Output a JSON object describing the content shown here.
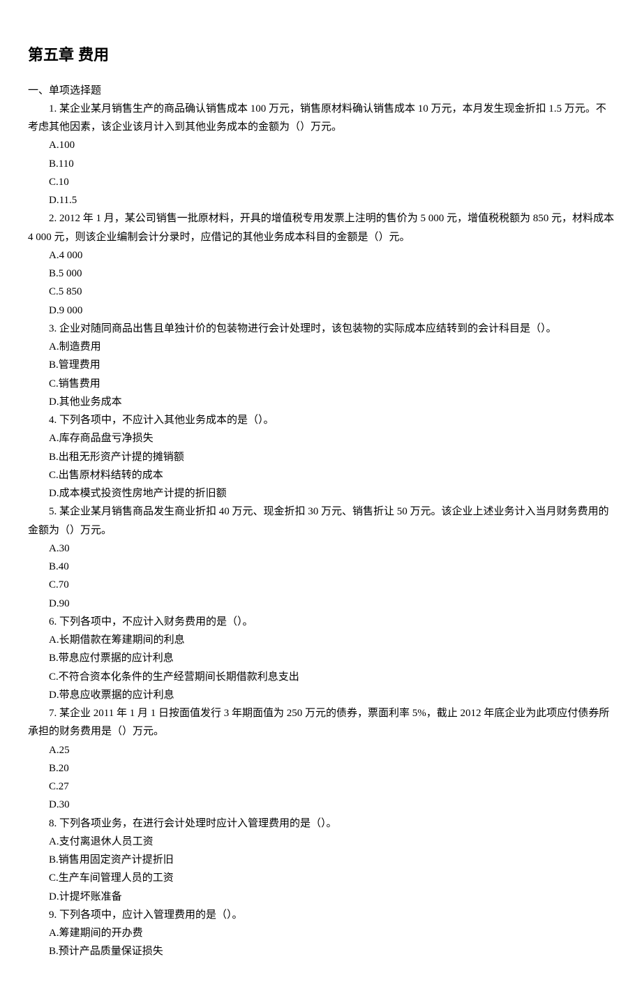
{
  "title": "第五章 费用",
  "sectionHeader": "一、单项选择题",
  "q1": {
    "text": "1. 某企业某月销售生产的商品确认销售成本 100 万元，销售原材料确认销售成本 10 万元，本月发生现金折扣 1.5 万元。不考虑其他因素，该企业该月计入到其他业务成本的金额为（）万元。",
    "a": "A.100",
    "b": "B.110",
    "c": "C.10",
    "d": "D.11.5"
  },
  "q2": {
    "text": "2. 2012 年 1 月，某公司销售一批原材料，开具的增值税专用发票上注明的售价为 5 000 元，增值税税额为 850 元，材料成本 4 000 元，则该企业编制会计分录时，应借记的其他业务成本科目的金额是（）元。",
    "a": "A.4 000",
    "b": "B.5 000",
    "c": "C.5 850",
    "d": "D.9 000"
  },
  "q3": {
    "text": "3. 企业对随同商品出售且单独计价的包装物进行会计处理时，该包装物的实际成本应结转到的会计科目是（）。",
    "a": "A.制造费用",
    "b": "B.管理费用",
    "c": "C.销售费用",
    "d": "D.其他业务成本"
  },
  "q4": {
    "text": "4. 下列各项中，不应计入其他业务成本的是（）。",
    "a": "A.库存商品盘亏净损失",
    "b": "B.出租无形资产计提的摊销额",
    "c": "C.出售原材料结转的成本",
    "d": "D.成本模式投资性房地产计提的折旧额"
  },
  "q5": {
    "text": "5. 某企业某月销售商品发生商业折扣 40 万元、现金折扣 30 万元、销售折让 50 万元。该企业上述业务计入当月财务费用的金额为（）万元。",
    "a": "A.30",
    "b": "B.40",
    "c": "C.70",
    "d": "D.90"
  },
  "q6": {
    "text": "6. 下列各项中，不应计入财务费用的是（）。",
    "a": "A.长期借款在筹建期间的利息",
    "b": "B.带息应付票据的应计利息",
    "c": "C.不符合资本化条件的生产经营期间长期借款利息支出",
    "d": "D.带息应收票据的应计利息"
  },
  "q7": {
    "text": "7. 某企业 2011 年 1 月 1 日按面值发行 3 年期面值为 250 万元的债券，票面利率 5%，截止 2012 年底企业为此项应付债券所承担的财务费用是（）万元。",
    "a": "A.25",
    "b": "B.20",
    "c": "C.27",
    "d": "D.30"
  },
  "q8": {
    "text": "8. 下列各项业务，在进行会计处理时应计入管理费用的是（）。",
    "a": "A.支付离退休人员工资",
    "b": "B.销售用固定资产计提折旧",
    "c": "C.生产车间管理人员的工资",
    "d": "D.计提坏账准备"
  },
  "q9": {
    "text": "9. 下列各项中，应计入管理费用的是（）。",
    "a": "A.筹建期间的开办费",
    "b": "B.预计产品质量保证损失"
  }
}
